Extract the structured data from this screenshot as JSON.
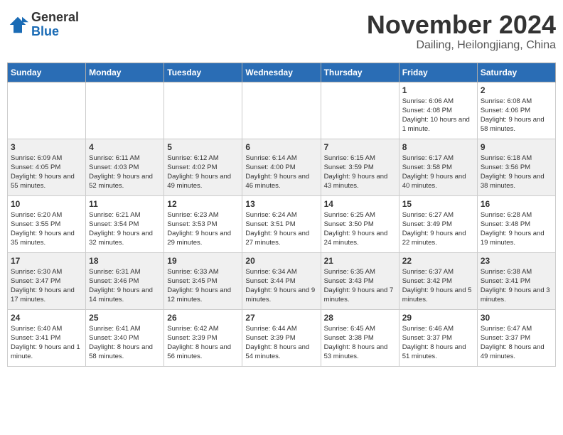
{
  "header": {
    "logo_general": "General",
    "logo_blue": "Blue",
    "month_title": "November 2024",
    "location": "Dailing, Heilongjiang, China"
  },
  "weekdays": [
    "Sunday",
    "Monday",
    "Tuesday",
    "Wednesday",
    "Thursday",
    "Friday",
    "Saturday"
  ],
  "weeks": [
    [
      {
        "day": "",
        "info": ""
      },
      {
        "day": "",
        "info": ""
      },
      {
        "day": "",
        "info": ""
      },
      {
        "day": "",
        "info": ""
      },
      {
        "day": "",
        "info": ""
      },
      {
        "day": "1",
        "info": "Sunrise: 6:06 AM\nSunset: 4:08 PM\nDaylight: 10 hours and 1 minute."
      },
      {
        "day": "2",
        "info": "Sunrise: 6:08 AM\nSunset: 4:06 PM\nDaylight: 9 hours and 58 minutes."
      }
    ],
    [
      {
        "day": "3",
        "info": "Sunrise: 6:09 AM\nSunset: 4:05 PM\nDaylight: 9 hours and 55 minutes."
      },
      {
        "day": "4",
        "info": "Sunrise: 6:11 AM\nSunset: 4:03 PM\nDaylight: 9 hours and 52 minutes."
      },
      {
        "day": "5",
        "info": "Sunrise: 6:12 AM\nSunset: 4:02 PM\nDaylight: 9 hours and 49 minutes."
      },
      {
        "day": "6",
        "info": "Sunrise: 6:14 AM\nSunset: 4:00 PM\nDaylight: 9 hours and 46 minutes."
      },
      {
        "day": "7",
        "info": "Sunrise: 6:15 AM\nSunset: 3:59 PM\nDaylight: 9 hours and 43 minutes."
      },
      {
        "day": "8",
        "info": "Sunrise: 6:17 AM\nSunset: 3:58 PM\nDaylight: 9 hours and 40 minutes."
      },
      {
        "day": "9",
        "info": "Sunrise: 6:18 AM\nSunset: 3:56 PM\nDaylight: 9 hours and 38 minutes."
      }
    ],
    [
      {
        "day": "10",
        "info": "Sunrise: 6:20 AM\nSunset: 3:55 PM\nDaylight: 9 hours and 35 minutes."
      },
      {
        "day": "11",
        "info": "Sunrise: 6:21 AM\nSunset: 3:54 PM\nDaylight: 9 hours and 32 minutes."
      },
      {
        "day": "12",
        "info": "Sunrise: 6:23 AM\nSunset: 3:53 PM\nDaylight: 9 hours and 29 minutes."
      },
      {
        "day": "13",
        "info": "Sunrise: 6:24 AM\nSunset: 3:51 PM\nDaylight: 9 hours and 27 minutes."
      },
      {
        "day": "14",
        "info": "Sunrise: 6:25 AM\nSunset: 3:50 PM\nDaylight: 9 hours and 24 minutes."
      },
      {
        "day": "15",
        "info": "Sunrise: 6:27 AM\nSunset: 3:49 PM\nDaylight: 9 hours and 22 minutes."
      },
      {
        "day": "16",
        "info": "Sunrise: 6:28 AM\nSunset: 3:48 PM\nDaylight: 9 hours and 19 minutes."
      }
    ],
    [
      {
        "day": "17",
        "info": "Sunrise: 6:30 AM\nSunset: 3:47 PM\nDaylight: 9 hours and 17 minutes."
      },
      {
        "day": "18",
        "info": "Sunrise: 6:31 AM\nSunset: 3:46 PM\nDaylight: 9 hours and 14 minutes."
      },
      {
        "day": "19",
        "info": "Sunrise: 6:33 AM\nSunset: 3:45 PM\nDaylight: 9 hours and 12 minutes."
      },
      {
        "day": "20",
        "info": "Sunrise: 6:34 AM\nSunset: 3:44 PM\nDaylight: 9 hours and 9 minutes."
      },
      {
        "day": "21",
        "info": "Sunrise: 6:35 AM\nSunset: 3:43 PM\nDaylight: 9 hours and 7 minutes."
      },
      {
        "day": "22",
        "info": "Sunrise: 6:37 AM\nSunset: 3:42 PM\nDaylight: 9 hours and 5 minutes."
      },
      {
        "day": "23",
        "info": "Sunrise: 6:38 AM\nSunset: 3:41 PM\nDaylight: 9 hours and 3 minutes."
      }
    ],
    [
      {
        "day": "24",
        "info": "Sunrise: 6:40 AM\nSunset: 3:41 PM\nDaylight: 9 hours and 1 minute."
      },
      {
        "day": "25",
        "info": "Sunrise: 6:41 AM\nSunset: 3:40 PM\nDaylight: 8 hours and 58 minutes."
      },
      {
        "day": "26",
        "info": "Sunrise: 6:42 AM\nSunset: 3:39 PM\nDaylight: 8 hours and 56 minutes."
      },
      {
        "day": "27",
        "info": "Sunrise: 6:44 AM\nSunset: 3:39 PM\nDaylight: 8 hours and 54 minutes."
      },
      {
        "day": "28",
        "info": "Sunrise: 6:45 AM\nSunset: 3:38 PM\nDaylight: 8 hours and 53 minutes."
      },
      {
        "day": "29",
        "info": "Sunrise: 6:46 AM\nSunset: 3:37 PM\nDaylight: 8 hours and 51 minutes."
      },
      {
        "day": "30",
        "info": "Sunrise: 6:47 AM\nSunset: 3:37 PM\nDaylight: 8 hours and 49 minutes."
      }
    ]
  ]
}
